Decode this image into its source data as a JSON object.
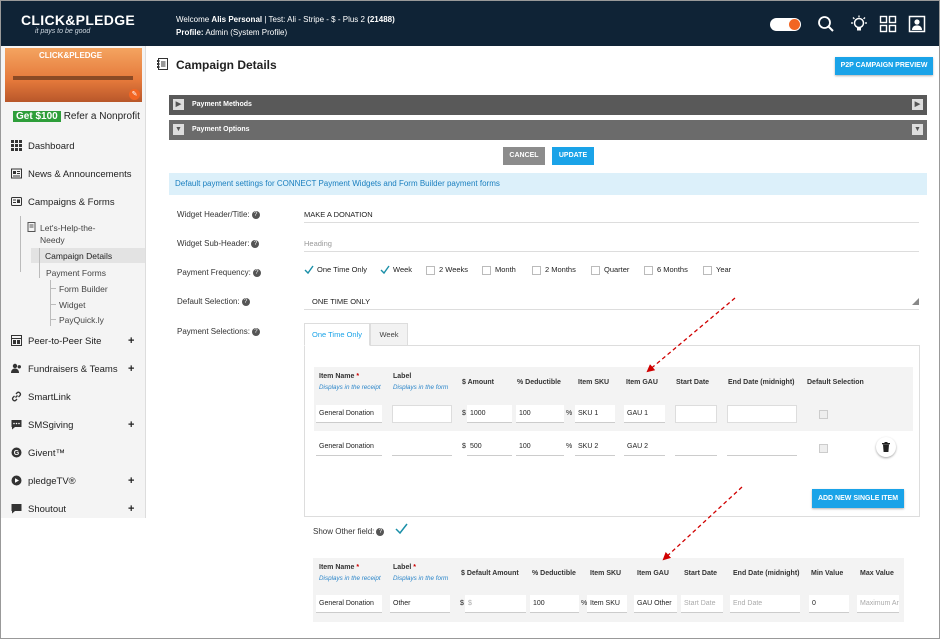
{
  "header": {
    "logo": "CLICK&PLEDGE",
    "tagline": "it pays to be good",
    "welcome_prefix": "Welcome ",
    "user_name": "Alis Personal",
    "account_text": " | Test: Ali - Stripe - $ - Plus 2 ",
    "account_id": "(21488)",
    "profile_label": "Profile:",
    "profile_value": " Admin (System Profile)",
    "icons": [
      "toggle",
      "search-icon",
      "lightbulb-icon",
      "apps-grid-icon",
      "user-profile-icon"
    ],
    "accent": "#f26522",
    "bg": "#0f2336"
  },
  "sidebar": {
    "banner_logo": "CLICK&PLEDGE",
    "refer_badge": "Get $100",
    "refer_text": "Refer a Nonprofit",
    "items": [
      {
        "label": "Dashboard",
        "icon": "dashboard-icon",
        "plus": ""
      },
      {
        "label": "News & Announcements",
        "icon": "news-icon",
        "plus": ""
      },
      {
        "label": "Campaigns & Forms",
        "icon": "campaigns-icon",
        "plus": ""
      }
    ],
    "campaign_name": "Let's-Help-the-Needy",
    "campaign_name_l1": "Let's-Help-the-",
    "campaign_name_l2": "Needy",
    "sub_items": [
      "Campaign Details",
      "Payment Forms"
    ],
    "form_items": [
      "Form Builder",
      "Widget",
      "PayQuick.ly"
    ],
    "bottom_items": [
      {
        "label": "Peer-to-Peer Site",
        "icon": "p2p-icon",
        "plus": "+"
      },
      {
        "label": "Fundraisers & Teams",
        "icon": "fundraisers-icon",
        "plus": "+"
      },
      {
        "label": "SmartLink",
        "icon": "link-icon",
        "plus": ""
      },
      {
        "label": "SMSgiving",
        "icon": "sms-icon",
        "plus": "+"
      },
      {
        "label": "Givent™",
        "icon": "givent-icon",
        "plus": ""
      },
      {
        "label": "pledgeTV®",
        "icon": "tv-icon",
        "plus": "+"
      },
      {
        "label": "Shoutout",
        "icon": "shoutout-icon",
        "plus": "+"
      }
    ]
  },
  "main": {
    "title": "Campaign Details",
    "p2p_button": "P2P CAMPAIGN PREVIEW",
    "accordions": [
      "Payment Methods",
      "Payment Options"
    ],
    "cancel": "CANCEL",
    "update": "UPDATE",
    "info": "Default payment settings for CONNECT Payment Widgets and Form Builder payment forms",
    "fields": {
      "widget_header_label": "Widget Header/Title:",
      "widget_header_value": "MAKE A DONATION",
      "widget_sub_label": "Widget Sub-Header:",
      "widget_sub_placeholder": "Heading",
      "frequency_label": "Payment Frequency:",
      "default_selection_label": "Default Selection:",
      "default_selection_value": "ONE TIME ONLY",
      "payment_selections_label": "Payment Selections:",
      "show_other_label": "Show Other field:"
    },
    "frequencies": [
      {
        "label": "One Time Only",
        "checked": true
      },
      {
        "label": "Week",
        "checked": true
      },
      {
        "label": "2 Weeks",
        "checked": false
      },
      {
        "label": "Month",
        "checked": false
      },
      {
        "label": "2 Months",
        "checked": false
      },
      {
        "label": "Quarter",
        "checked": false
      },
      {
        "label": "6 Months",
        "checked": false
      },
      {
        "label": "Year",
        "checked": false
      }
    ],
    "tabs": [
      "One Time Only",
      "Week"
    ],
    "table1": {
      "headers": [
        "Item Name",
        "Label",
        "$ Amount",
        "% Deductible",
        "Item SKU",
        "Item GAU",
        "Start Date",
        "End Date (midnight)",
        "Default Selection"
      ],
      "sub_item_name": "Displays in the receipt",
      "sub_label": "Displays in the form",
      "required_mark": "*",
      "rows": [
        {
          "name": "General Donation",
          "label": "",
          "currency": "$",
          "amount": "1000",
          "deductible": "100",
          "pct": "%",
          "sku": "SKU 1",
          "gau": "GAU 1"
        },
        {
          "name": "General Donation",
          "label": "",
          "currency": "$",
          "amount": "500",
          "deductible": "100",
          "pct": "%",
          "sku": "SKU 2",
          "gau": "GAU 2"
        }
      ],
      "add_button": "ADD NEW SINGLE ITEM"
    },
    "table2": {
      "headers": [
        "Item Name",
        "Label",
        "$ Default Amount",
        "% Deductible",
        "Item SKU",
        "Item GAU",
        "Start Date",
        "End Date (midnight)",
        "Min Value",
        "Max Value"
      ],
      "sub_item_name": "Displays in the receipt",
      "sub_label": "Displays in the form",
      "row": {
        "name": "General Donation",
        "label": "Other",
        "currency": "$",
        "amount_placeholder": "$",
        "deductible": "100",
        "pct": "%",
        "sku": "Item SKU",
        "gau": "GAU Other",
        "start_placeholder": "Start Date",
        "end_placeholder": "End Date",
        "min": "0",
        "max_placeholder": "Maximum Ar"
      }
    },
    "colors": {
      "primary": "#1aa3e8",
      "cancel": "#8c8c8c",
      "check": "#1a8fa8",
      "arrow": "#d00000"
    }
  }
}
